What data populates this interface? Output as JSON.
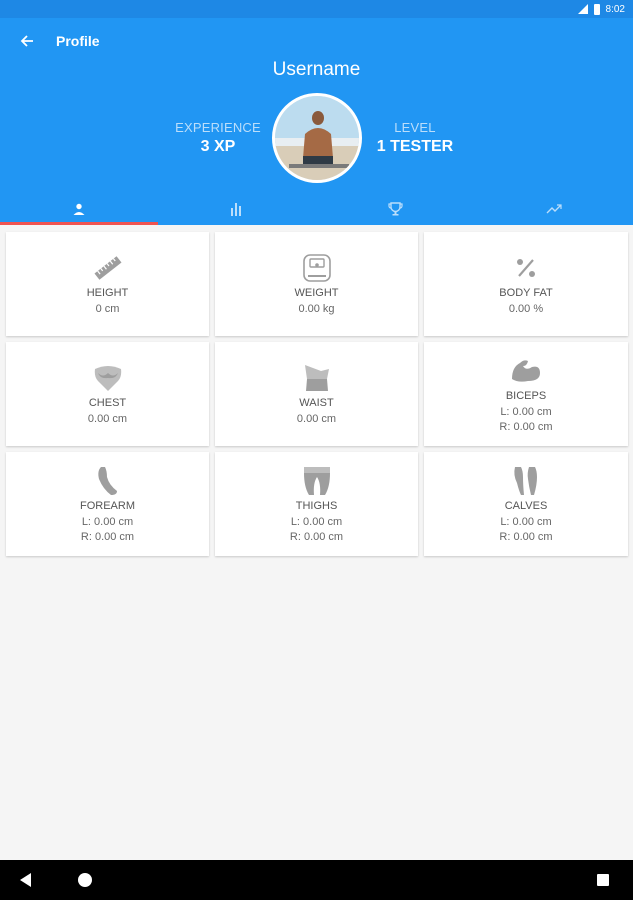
{
  "status_bar": {
    "time": "8:02"
  },
  "header": {
    "title": "Profile",
    "username": "Username",
    "experience_label": "EXPERIENCE",
    "experience_value": "3 XP",
    "level_label": "LEVEL",
    "level_value": "1 TESTER"
  },
  "tabs": [
    {
      "icon": "person-icon",
      "active": true
    },
    {
      "icon": "bar-chart-icon",
      "active": false
    },
    {
      "icon": "trophy-icon",
      "active": false
    },
    {
      "icon": "trending-icon",
      "active": false
    }
  ],
  "measurements": [
    {
      "title": "HEIGHT",
      "value": "0 cm",
      "icon": "ruler-icon"
    },
    {
      "title": "WEIGHT",
      "value": "0.00 kg",
      "icon": "scale-icon"
    },
    {
      "title": "BODY FAT",
      "value": "0.00 %",
      "icon": "percent-icon"
    },
    {
      "title": "CHEST",
      "value": "0.00 cm",
      "icon": "chest-icon"
    },
    {
      "title": "WAIST",
      "value": "0.00 cm",
      "icon": "waist-icon"
    },
    {
      "title": "BICEPS",
      "left": "L: 0.00 cm",
      "right": "R: 0.00 cm",
      "icon": "biceps-icon"
    },
    {
      "title": "FOREARM",
      "left": "L: 0.00 cm",
      "right": "R: 0.00 cm",
      "icon": "forearm-icon"
    },
    {
      "title": "THIGHS",
      "left": "L: 0.00 cm",
      "right": "R: 0.00 cm",
      "icon": "thighs-icon"
    },
    {
      "title": "CALVES",
      "left": "L: 0.00 cm",
      "right": "R: 0.00 cm",
      "icon": "calves-icon"
    }
  ],
  "colors": {
    "primary": "#2196f3",
    "status_bar": "#1e88e5",
    "tab_indicator": "#ef5350",
    "icon_gray": "#9e9e9e"
  }
}
